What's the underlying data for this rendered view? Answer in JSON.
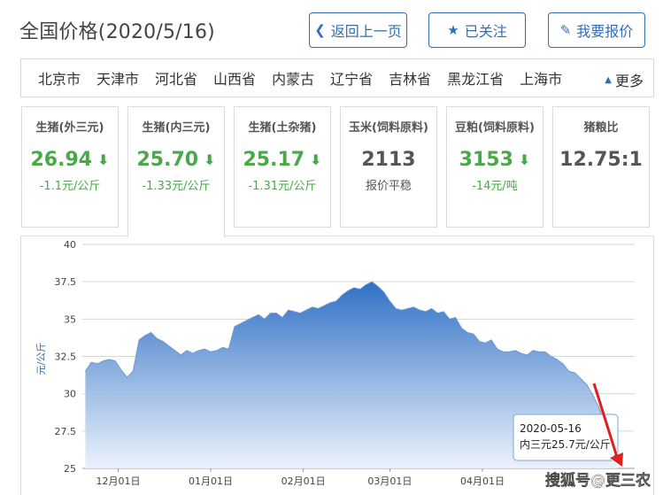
{
  "header": {
    "title": "全国价格(2020/5/16)",
    "buttons": [
      {
        "label": "返回上一页",
        "icon": "chevron-left-icon"
      },
      {
        "label": "已关注",
        "icon": "star-icon"
      },
      {
        "label": "我要报价",
        "icon": "edit-icon"
      }
    ]
  },
  "regions": {
    "items": [
      "北京市",
      "天津市",
      "河北省",
      "山西省",
      "内蒙古",
      "辽宁省",
      "吉林省",
      "黑龙江省",
      "上海市"
    ],
    "more_label": "更多"
  },
  "cards": [
    {
      "name": "生猪(外三元)",
      "value": "26.94",
      "trend": "down",
      "change": "-1.1元/公斤"
    },
    {
      "name": "生猪(内三元)",
      "value": "25.70",
      "trend": "down",
      "change": "-1.33元/公斤"
    },
    {
      "name": "生猪(土杂猪)",
      "value": "25.17",
      "trend": "down",
      "change": "-1.31元/公斤"
    },
    {
      "name": "玉米(饲料原料)",
      "value": "2113",
      "trend": "flat",
      "change": "报价平稳"
    },
    {
      "name": "豆粕(饲料原料)",
      "value": "3153",
      "trend": "down",
      "change": "-14元/吨"
    },
    {
      "name": "猪粮比",
      "value": "12.75:1",
      "trend": "none",
      "change": ""
    }
  ],
  "colors": {
    "accent": "#2f6fb8",
    "down_green": "#4aa84a",
    "area_top": "#2f6fc4",
    "area_bottom": "#e8f0fb",
    "arrow_red": "#e02020"
  },
  "chart_data": {
    "type": "area",
    "title": "",
    "xlabel": "",
    "ylabel": "元/公斤",
    "ylim": [
      25,
      40
    ],
    "yticks": [
      "25",
      "27.5",
      "30",
      "32.5",
      "35",
      "37.5",
      "40"
    ],
    "xtick_labels": [
      "12月01日",
      "01月01日",
      "02月01日",
      "03月01日",
      "04月01日"
    ],
    "xtick_dates": [
      "2019-12-01",
      "2020-01-01",
      "2020-02-01",
      "2020-03-01",
      "2020-04-01"
    ],
    "grid": true,
    "series": [
      {
        "name": "内三元",
        "x": [
          "2019-11-20",
          "2019-11-22",
          "2019-11-24",
          "2019-11-26",
          "2019-11-28",
          "2019-11-30",
          "2019-12-02",
          "2019-12-04",
          "2019-12-06",
          "2019-12-08",
          "2019-12-10",
          "2019-12-12",
          "2019-12-14",
          "2019-12-16",
          "2019-12-18",
          "2019-12-20",
          "2019-12-22",
          "2019-12-24",
          "2019-12-26",
          "2019-12-28",
          "2019-12-30",
          "2020-01-01",
          "2020-01-03",
          "2020-01-05",
          "2020-01-07",
          "2020-01-09",
          "2020-01-11",
          "2020-01-13",
          "2020-01-15",
          "2020-01-17",
          "2020-01-19",
          "2020-01-21",
          "2020-01-23",
          "2020-01-25",
          "2020-01-27",
          "2020-01-29",
          "2020-01-31",
          "2020-02-02",
          "2020-02-04",
          "2020-02-06",
          "2020-02-08",
          "2020-02-10",
          "2020-02-12",
          "2020-02-14",
          "2020-02-16",
          "2020-02-18",
          "2020-02-20",
          "2020-02-22",
          "2020-02-24",
          "2020-02-26",
          "2020-02-28",
          "2020-03-01",
          "2020-03-03",
          "2020-03-05",
          "2020-03-07",
          "2020-03-09",
          "2020-03-11",
          "2020-03-13",
          "2020-03-15",
          "2020-03-17",
          "2020-03-19",
          "2020-03-21",
          "2020-03-23",
          "2020-03-25",
          "2020-03-27",
          "2020-03-29",
          "2020-03-31",
          "2020-04-02",
          "2020-04-04",
          "2020-04-06",
          "2020-04-08",
          "2020-04-10",
          "2020-04-12",
          "2020-04-14",
          "2020-04-16",
          "2020-04-18",
          "2020-04-20",
          "2020-04-22",
          "2020-04-24",
          "2020-04-26",
          "2020-04-28",
          "2020-04-30",
          "2020-05-02",
          "2020-05-04",
          "2020-05-06",
          "2020-05-08",
          "2020-05-10",
          "2020-05-12",
          "2020-05-14",
          "2020-05-16"
        ],
        "values": [
          31.5,
          32.1,
          32.0,
          32.2,
          32.3,
          32.2,
          31.6,
          31.1,
          31.5,
          33.6,
          33.9,
          34.1,
          33.7,
          33.5,
          33.2,
          32.9,
          32.6,
          32.9,
          32.7,
          32.9,
          33.0,
          32.8,
          32.9,
          33.1,
          33.0,
          34.5,
          34.7,
          34.9,
          35.1,
          35.3,
          35.0,
          35.4,
          35.4,
          35.1,
          35.6,
          35.5,
          35.4,
          35.6,
          35.8,
          35.7,
          35.9,
          36.1,
          36.2,
          36.6,
          36.9,
          37.1,
          37.0,
          37.3,
          37.5,
          37.2,
          36.8,
          36.2,
          35.7,
          35.6,
          35.7,
          35.8,
          35.6,
          35.5,
          35.7,
          35.4,
          35.5,
          35.0,
          35.1,
          34.4,
          34.1,
          34.0,
          33.5,
          33.4,
          33.6,
          33.0,
          32.8,
          32.8,
          32.9,
          32.7,
          32.6,
          32.9,
          32.8,
          32.8,
          32.5,
          32.3,
          32.0,
          31.5,
          31.4,
          31.0,
          30.6,
          29.9,
          29.1,
          28.0,
          26.8,
          25.7
        ]
      }
    ],
    "tooltip": {
      "date": "2020-05-16",
      "text": "内三元25.7元/公斤"
    },
    "legend": "none"
  },
  "watermark": "搜狐号@更三农"
}
